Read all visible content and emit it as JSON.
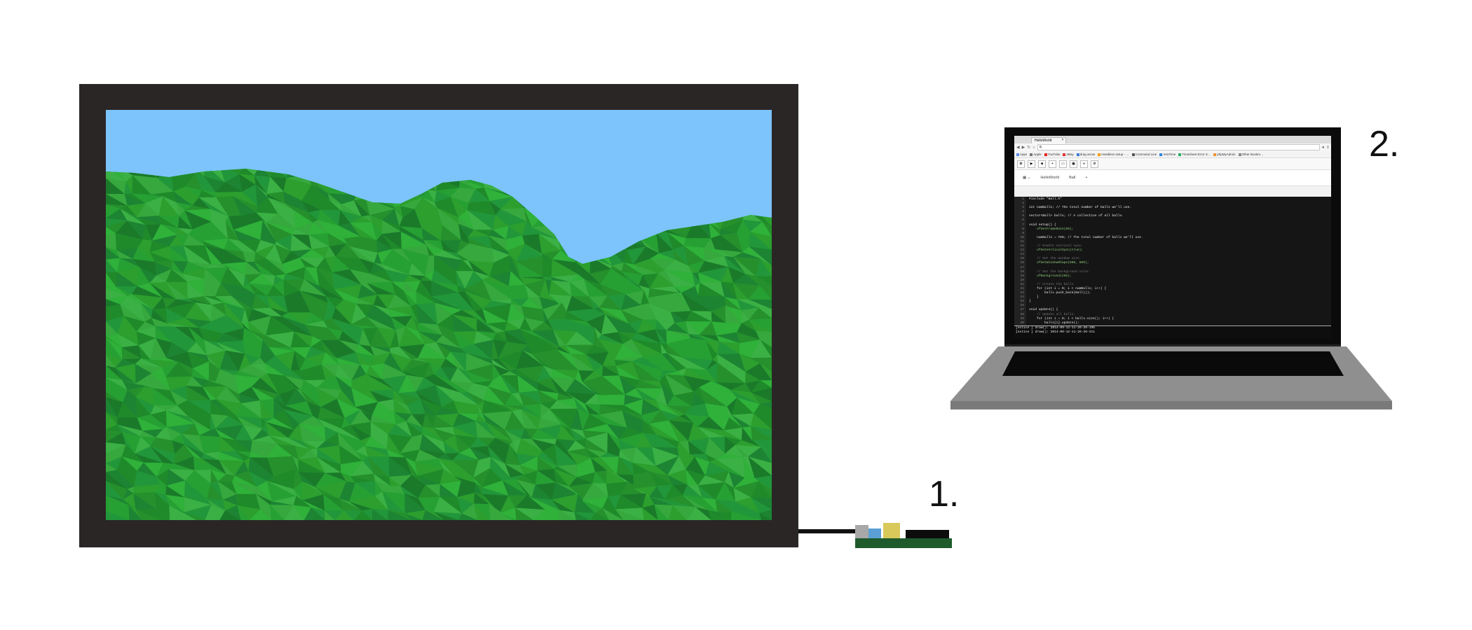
{
  "labels": {
    "step1": "1.",
    "step2": "2."
  },
  "colors": {
    "frame": "#2a2626",
    "sky": "#7cc4fb",
    "grass": [
      "#1f8a2a",
      "#27a033",
      "#2fb13a",
      "#1a7a2a",
      "#36a83d",
      "#22963a",
      "#2c9f2e",
      "#1c8433",
      "#3bb044",
      "#25902c"
    ],
    "laptop_body": "#8f8f8f",
    "board": "#1f5a2c"
  },
  "laptop": {
    "browser": {
      "tab_title": "HelloWorld",
      "tab_close": "×",
      "url": "q",
      "bookmarks": [
        {
          "label": "Apps",
          "color": "#5b8def"
        },
        {
          "label": "Apple",
          "color": "#777777"
        },
        {
          "label": "YouTube",
          "color": "#e62117"
        },
        {
          "label": "eBay",
          "color": "#e53238"
        },
        {
          "label": "drag arrow",
          "color": "#3a7bd5"
        },
        {
          "label": "Headless setup - …",
          "color": "#f39c12"
        },
        {
          "label": "Command Line",
          "color": "#555555"
        },
        {
          "label": "ArtoTime",
          "color": "#2e86de"
        },
        {
          "label": "Timesheet Error S…",
          "color": "#27ae60"
        },
        {
          "label": "phpMyAdmin",
          "color": "#f0932b"
        },
        {
          "label": "Other Bookm…",
          "color": "#888888"
        }
      ]
    },
    "file_tabs": [
      "HelloWorld",
      "Ball"
    ],
    "code_lines": [
      {
        "n": "1",
        "t": "#include \"Ball.h\""
      },
      {
        "n": "2",
        "t": ""
      },
      {
        "n": "3",
        "t": "int numBalls; // The total number of balls we'll use."
      },
      {
        "n": "4",
        "t": ""
      },
      {
        "n": "5",
        "t": "vector<Ball> balls; // A collection of all balls."
      },
      {
        "n": "6",
        "t": ""
      },
      {
        "n": "7",
        "t": "void setup() {"
      },
      {
        "n": "8",
        "t": "    ofSetFrameRate(60);"
      },
      {
        "n": "9",
        "t": ""
      },
      {
        "n": "10",
        "t": "    numBalls = 750; // The total number of balls we'll use."
      },
      {
        "n": "11",
        "t": ""
      },
      {
        "n": "12",
        "t": "    // Enable vertical sync."
      },
      {
        "n": "13",
        "t": "    ofSetVerticalSync(true);"
      },
      {
        "n": "14",
        "t": ""
      },
      {
        "n": "15",
        "t": "    // Set the window size."
      },
      {
        "n": "16",
        "t": "    ofSetWindowShape(500, 500);"
      },
      {
        "n": "17",
        "t": ""
      },
      {
        "n": "18",
        "t": "    // Set the background color."
      },
      {
        "n": "19",
        "t": "    ofBackground(255);"
      },
      {
        "n": "20",
        "t": ""
      },
      {
        "n": "21",
        "t": "    // Create the balls."
      },
      {
        "n": "22",
        "t": "    for (int i = 0; i < numBalls; i++) {"
      },
      {
        "n": "23",
        "t": "        balls.push_back(Ball());"
      },
      {
        "n": "24",
        "t": "    }"
      },
      {
        "n": "25",
        "t": "}"
      },
      {
        "n": "26",
        "t": ""
      },
      {
        "n": "27",
        "t": "void update() {"
      },
      {
        "n": "28",
        "t": "    // Update all balls."
      },
      {
        "n": "29",
        "t": "    for (int i = 0; i < balls.size(); i++) {"
      },
      {
        "n": "30",
        "t": "        balls[i].update();"
      }
    ],
    "console_lines": [
      "[notice ] draw(): 2014-09-12-11-26-26-195",
      "[notice ] draw(): 2014-09-12-11-26-26-211"
    ]
  }
}
